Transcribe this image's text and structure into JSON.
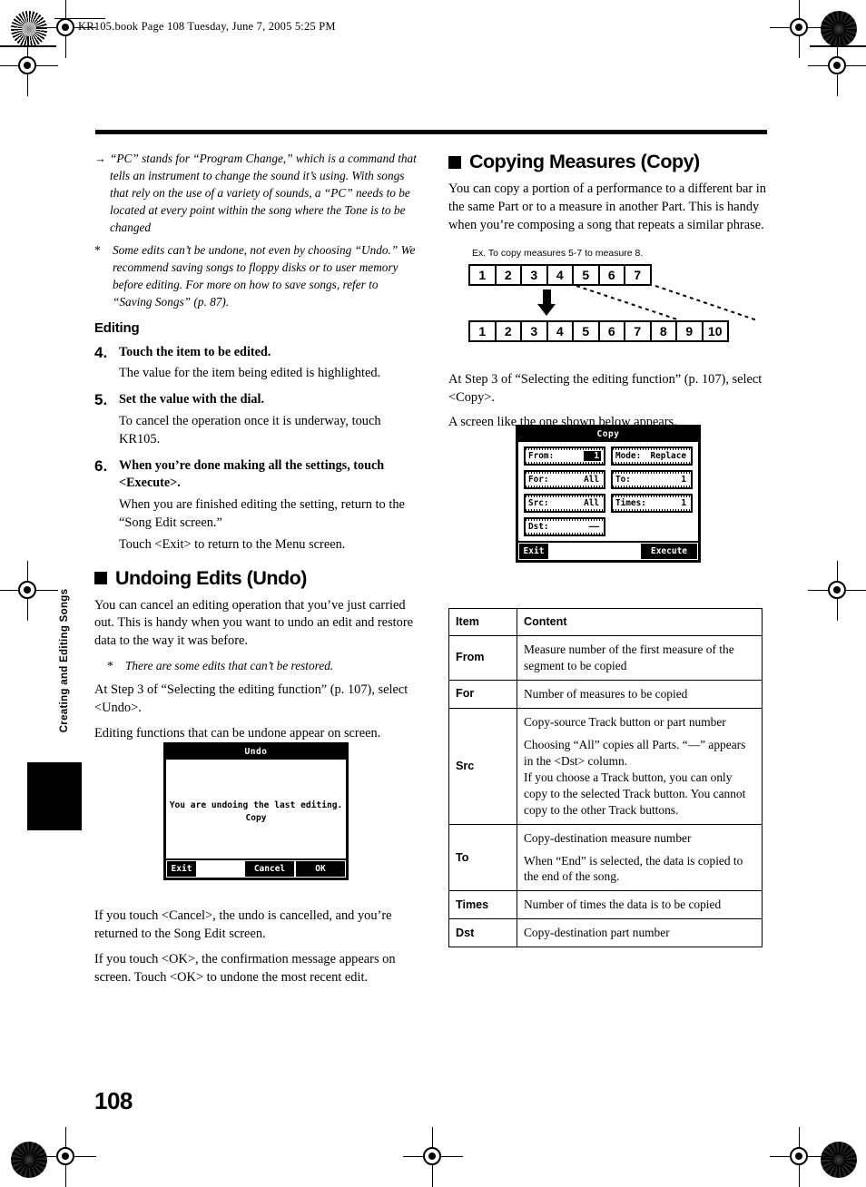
{
  "running_header": "KR105.book  Page 108  Tuesday, June 7, 2005  5:25 PM",
  "page_number": "108",
  "side_tab": {
    "label": "Creating and Editing Songs"
  },
  "left_column": {
    "note_pc": {
      "marker": "→",
      "text": "“PC” stands for “Program Change,” which is a command that tells an instrument to change the sound it’s using. With songs that rely on the use of a variety of sounds, a “PC” needs to be located at every point within the song where the Tone is to be changed"
    },
    "note_undo_warning": {
      "marker": "*",
      "text": "Some edits can’t be undone, not even by choosing “Undo.” We recommend saving songs to floppy disks or to user memory before editing. For more on how to save songs, refer to “Saving Songs” (p. 87)."
    },
    "editing_heading": "Editing",
    "steps": [
      {
        "number": "4.",
        "title": "Touch the item to be edited.",
        "body": [
          "The value for the item being edited is highlighted."
        ]
      },
      {
        "number": "5.",
        "title": "Set the value with the dial.",
        "body": [
          "To cancel the operation once it is underway, touch KR105."
        ]
      },
      {
        "number": "6.",
        "title": "When you’re done making all the settings, touch <Execute>.",
        "body": [
          "When you are finished editing the setting, return to the “Song Edit screen.”",
          "Touch <Exit> to return to the Menu screen."
        ]
      }
    ],
    "undo_heading": "Undoing Edits (Undo)",
    "undo_intro": "You can cancel an editing operation that you’ve just carried out. This is handy when you want to undo an edit and restore data to the way it was before.",
    "undo_note": {
      "marker": "*",
      "text": "There are some edits that can’t be restored."
    },
    "undo_step3": "At Step 3 of “Selecting the editing function” (p. 107), select <Undo>.",
    "undo_appear": "Editing functions that can be undone appear on screen.",
    "undo_screen": {
      "title": "Undo",
      "message_line1": "You are undoing the last editing.",
      "message_line2": "Copy",
      "buttons": {
        "exit": "Exit",
        "cancel": "Cancel",
        "ok": "OK"
      }
    },
    "after_undo_1": "If you touch <Cancel>, the undo is cancelled, and you’re returned to the Song Edit screen.",
    "after_undo_2": "If you touch <OK>, the confirmation message appears on screen. Touch <OK> to undone the most recent edit."
  },
  "right_column": {
    "copy_heading": "Copying Measures (Copy)",
    "copy_intro": "You can copy a portion of a performance to a different bar in the same Part or to a measure in another Part. This is handy when you’re composing a song that repeats a similar phrase.",
    "example_label": "Ex. To copy measures 5-7 to measure 8.",
    "diagram": {
      "top_row": [
        "1",
        "2",
        "3",
        "4",
        "5",
        "6",
        "7"
      ],
      "bottom_row": [
        "1",
        "2",
        "3",
        "4",
        "5",
        "6",
        "7",
        "8",
        "9",
        "10"
      ]
    },
    "copy_step3": "At Step 3 of “Selecting the editing function” (p. 107), select <Copy>.",
    "copy_appear": "A screen like the one shown below appears.",
    "copy_screen": {
      "title": "Copy",
      "fields_left": [
        {
          "label": "From:",
          "value": "1",
          "highlighted": true
        },
        {
          "label": "For:",
          "value": "All",
          "highlighted": false
        },
        {
          "label": "Src:",
          "value": "All",
          "highlighted": false
        },
        {
          "label": "Dst:",
          "value": "——",
          "highlighted": false
        }
      ],
      "fields_right": [
        {
          "label": "Mode:",
          "value": "Replace",
          "highlighted": false
        },
        {
          "label": "To:",
          "value": "1",
          "highlighted": false
        },
        {
          "label": "Times:",
          "value": "1",
          "highlighted": false
        }
      ],
      "buttons": {
        "exit": "Exit",
        "execute": "Execute"
      }
    },
    "table": {
      "headers": [
        "Item",
        "Content"
      ],
      "rows": [
        {
          "item": "From",
          "content": [
            "Measure number of the first measure of the segment to be copied"
          ]
        },
        {
          "item": "For",
          "content": [
            "Number of measures to be copied"
          ]
        },
        {
          "item": "Src",
          "content": [
            "Copy-source Track button or part number",
            "Choosing “All” copies all Parts. “—” appears in the <Dst> column.",
            "If you choose a Track button, you can only copy to the selected Track button. You cannot copy to the other Track buttons."
          ]
        },
        {
          "item": "To",
          "content": [
            "Copy-destination measure number",
            "When “End” is selected, the data is copied to the end of the song."
          ]
        },
        {
          "item": "Times",
          "content": [
            "Number of times the data is to be copied"
          ]
        },
        {
          "item": "Dst",
          "content": [
            "Copy-destination part number"
          ]
        }
      ]
    }
  }
}
